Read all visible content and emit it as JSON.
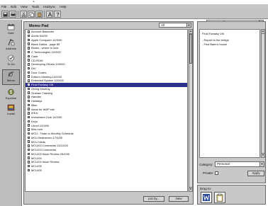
{
  "menubar": {
    "items": [
      "File",
      "Edit",
      "View",
      "Tools",
      "HotSync",
      "Help"
    ]
  },
  "header": {
    "user_label": "User:",
    "user_value": "Richard Hill"
  },
  "sidebar": {
    "items": [
      {
        "label": "Date"
      },
      {
        "label": "Address"
      },
      {
        "label": "To Do"
      },
      {
        "label": "Memo"
      },
      {
        "label": "Expense"
      },
      {
        "label": "Install"
      }
    ]
  },
  "memo": {
    "title": "Memo Pad",
    "category_value": "All",
    "items": [
      "Account Balances",
      "Anvils 6/4/00",
      "Apple Computer 10/3/00",
      "Black Dahlia - page 85",
      "Books - where to look",
      "C Technologies 10/2/00",
      "Cash",
      "CD-ROM",
      "Developing Others 10/5/00",
      "DIV",
      "Door Codes",
      "Editor's Meeting 10/2/00",
      "Extended System 10/2/00",
      "Final Fantasy VIII",
      "Giving Monthly",
      "Graham Training",
      "Handler",
      "Holidays",
      "iMac",
      "Ideas for WAP site",
      "IKEA",
      "Investment Club 14/2/00",
      "Keys",
      "Libreli 12/3/00",
      "Mac.com",
      "MCU - Team to Monthly Schedule",
      "MCU Brainstorm 17/4/00",
      "MCU Ideas",
      "MCU/03 Comments 22/12/00",
      "MCU/03 Comments",
      "MCU/03 Issue Review 25/2/00",
      "MCU/04",
      "MCU/04 Issue Review",
      "MCU/05",
      "MCU/05"
    ],
    "selected_index": 13,
    "list_by_label": "List by...",
    "new_label": "New"
  },
  "note": {
    "title": "Final Fantasy VIII",
    "lines": [
      "- Report to the bridge",
      "- Find Balm's house"
    ],
    "category_label": "Category:",
    "category_value": "Personal",
    "private_label": "Private:",
    "apply_label": "Apply"
  },
  "drag": {
    "label": "Drag to:"
  },
  "colors": {
    "selection": "#2e2f8c",
    "chrome": "#c8c8c8"
  }
}
